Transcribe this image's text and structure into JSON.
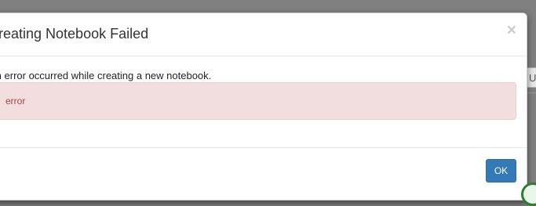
{
  "background": {
    "partial_button_label": "Up"
  },
  "dialog": {
    "title": "Creating Notebook Failed",
    "close_label": "×",
    "message": "An error occurred while creating a new notebook.",
    "error_text": "error",
    "ok_label": "OK"
  },
  "colors": {
    "overlay": "#808080",
    "alert_bg": "#f2dede",
    "alert_text": "#a94442",
    "primary": "#337ab7"
  }
}
